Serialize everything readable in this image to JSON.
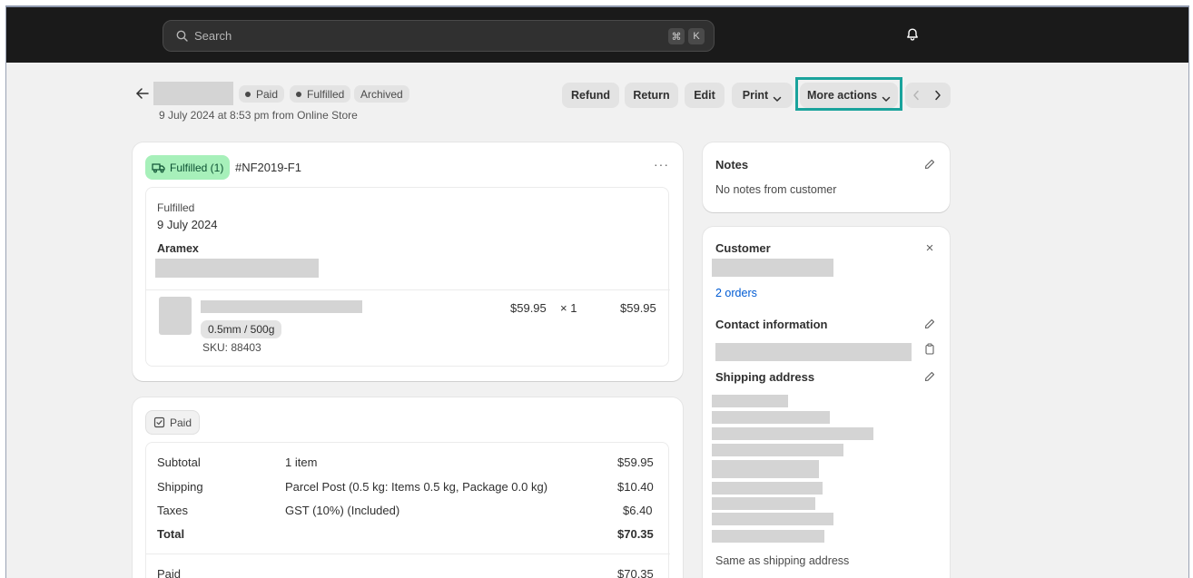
{
  "topbar": {
    "search_placeholder": "Search",
    "shortcut_keys": [
      "⌘",
      "K"
    ],
    "icons": {
      "search": "search-icon",
      "notifications": "bell-icon"
    }
  },
  "order_header": {
    "badges": [
      "Paid",
      "Fulfilled",
      "Archived"
    ],
    "subtitle": "9 July 2024 at 8:53 pm from Online Store"
  },
  "actions": {
    "refund": "Refund",
    "return": "Return",
    "edit": "Edit",
    "print": "Print",
    "more_actions": "More actions"
  },
  "fulfillment": {
    "status_label": "Fulfilled (1)",
    "fulfillment_id": "#NF2019-F1",
    "status": "Fulfilled",
    "date": "9 July 2024",
    "carrier": "Aramex",
    "line_item": {
      "price": "$59.95",
      "quantity": "× 1",
      "total": "$59.95",
      "variant": "0.5mm / 500g",
      "sku": "SKU: 88403"
    }
  },
  "payment": {
    "status_label": "Paid",
    "rows": [
      {
        "label": "Subtotal",
        "detail": "1 item",
        "amount": "$59.95"
      },
      {
        "label": "Shipping",
        "detail": "Parcel Post (0.5 kg: Items 0.5 kg, Package 0.0 kg)",
        "amount": "$10.40"
      },
      {
        "label": "Taxes",
        "detail": "GST (10%) (Included)",
        "amount": "$6.40"
      }
    ],
    "total_label": "Total",
    "total_amount": "$70.35",
    "paid_label": "Paid",
    "paid_amount": "$70.35"
  },
  "notes": {
    "title": "Notes",
    "body": "No notes from customer"
  },
  "customer": {
    "title": "Customer",
    "orders_link": "2 orders",
    "contact_title": "Contact information",
    "shipping_title": "Shipping address",
    "billing_note": "Same as shipping address"
  },
  "colors": {
    "topbar": "#1a1a1a",
    "highlight": "#1aa39c",
    "fulfilled_badge": "#a7f0ba",
    "link": "#005bd3"
  }
}
